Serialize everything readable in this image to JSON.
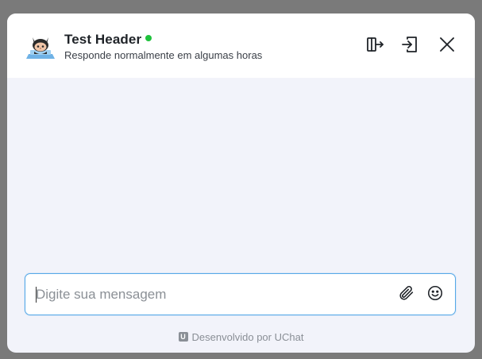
{
  "header": {
    "title": "Test Header",
    "status": "online",
    "status_color": "#1fc23c",
    "subtitle": "Responde normalmente em algumas horas",
    "avatar_icon": "octocat-avatar-icon",
    "actions": [
      {
        "name": "popout-icon"
      },
      {
        "name": "login-icon"
      },
      {
        "name": "close-icon"
      }
    ]
  },
  "composer": {
    "placeholder": "Digite sua mensagem",
    "value": "",
    "attach_icon": "paperclip-icon",
    "emoji_icon": "smiley-icon",
    "focus_color": "#56a9e8"
  },
  "footer": {
    "logo_letter": "U",
    "text": "Desenvolvido por UChat"
  },
  "colors": {
    "backdrop": "#7a7a7a",
    "body_background": "#f2f3fa",
    "header_background": "#ffffff"
  }
}
